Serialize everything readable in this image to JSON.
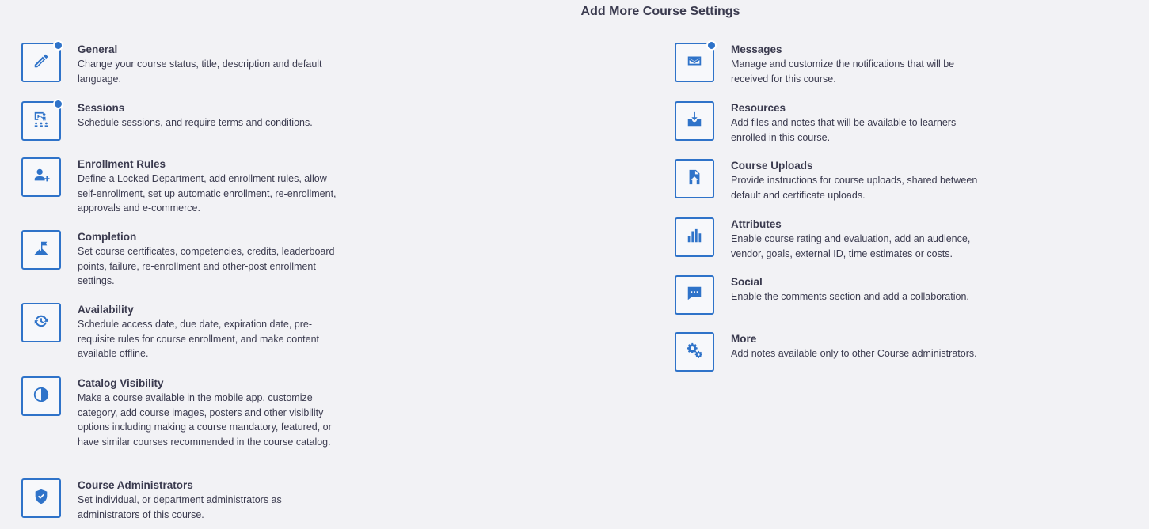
{
  "header": {
    "title": "Add More Course Settings"
  },
  "left_settings": [
    {
      "title": "General",
      "description": "Change your course status, title, description and default language.",
      "icon": "pencil-icon",
      "has_indicator": true
    },
    {
      "title": "Sessions",
      "description": "Schedule sessions, and require terms and conditions.",
      "icon": "presentation-icon",
      "has_indicator": true
    },
    {
      "title": "Enrollment Rules",
      "description": "Define a Locked Department, add enrollment rules, allow self-enrollment, set up automatic enrollment, re-enrollment, approvals and e-commerce.",
      "icon": "add-user-icon",
      "has_indicator": false
    },
    {
      "title": "Completion",
      "description": "Set course certificates, competencies, credits, leaderboard points, failure, re-enrollment and other-post enrollment settings.",
      "icon": "flag-mountain-icon",
      "has_indicator": false
    },
    {
      "title": "Availability",
      "description": "Schedule access date, due date, expiration date, pre-requisite rules for course enrollment, and make content available offline.",
      "icon": "refresh-clock-icon",
      "has_indicator": false
    },
    {
      "title": "Catalog Visibility",
      "description": "Make a course available in the mobile app, customize category, add course images, posters and other visibility options including making a course mandatory, featured, or have similar courses recommended in the course catalog.",
      "icon": "visibility-contrast-icon",
      "has_indicator": false
    },
    {
      "title": "Course Administrators",
      "description": "Set individual, or department administrators as administrators of this course.",
      "icon": "shield-check-icon",
      "has_indicator": false
    }
  ],
  "right_settings": [
    {
      "title": "Messages",
      "description": "Manage and customize the notifications that will be received for this course.",
      "icon": "envelope-icon",
      "has_indicator": true
    },
    {
      "title": "Resources",
      "description": "Add files and notes that will be available to learners enrolled in this course.",
      "icon": "inbox-download-icon",
      "has_indicator": false
    },
    {
      "title": "Course Uploads",
      "description": "Provide instructions for course uploads, shared between default and certificate uploads.",
      "icon": "upload-file-icon",
      "has_indicator": false
    },
    {
      "title": "Attributes",
      "description": "Enable course rating and evaluation, add an audience, vendor, goals, external ID, time estimates or costs.",
      "icon": "bar-chart-icon",
      "has_indicator": false
    },
    {
      "title": "Social",
      "description": "Enable the comments section and add a collaboration.",
      "icon": "chat-bubble-icon",
      "has_indicator": false
    },
    {
      "title": "More",
      "description": "Add notes available only to other Course administrators.",
      "icon": "gears-icon",
      "has_indicator": false
    }
  ],
  "colors": {
    "accent": "#2f73c9",
    "background": "#f2f2f5",
    "text": "#3b3b4f"
  }
}
